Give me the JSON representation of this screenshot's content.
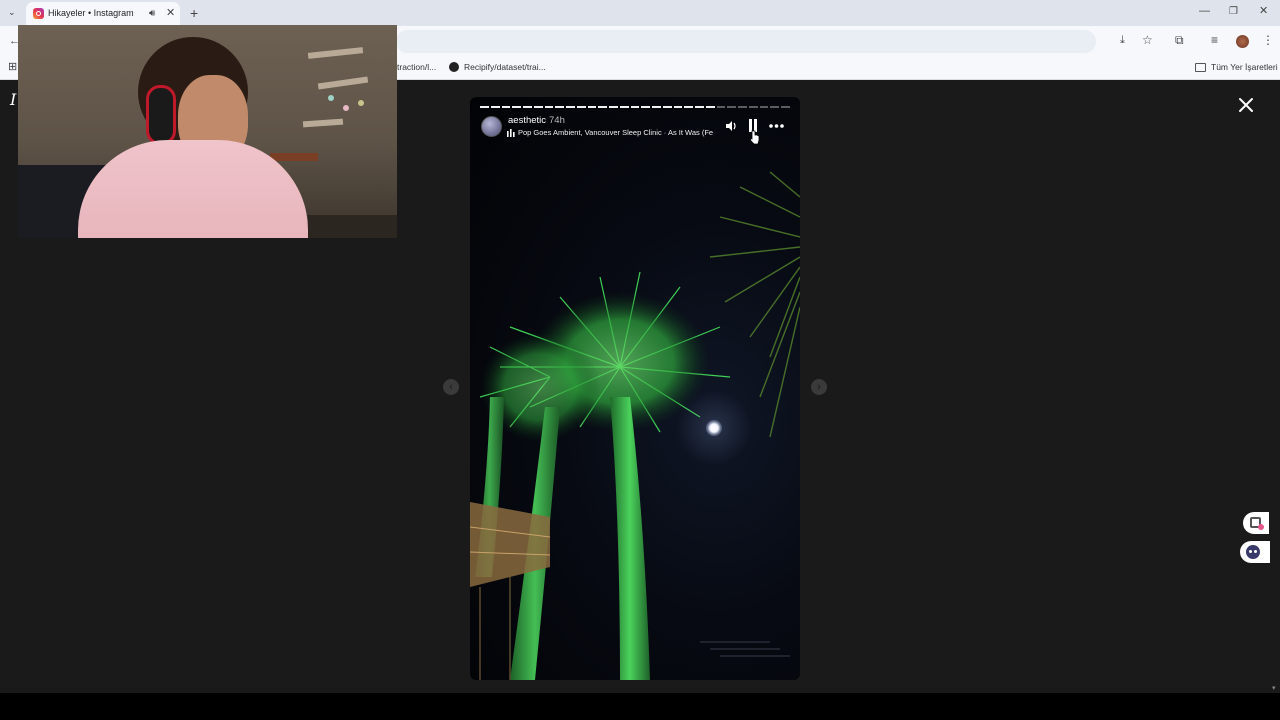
{
  "browser": {
    "tab_title": "Hikayeler • Instagram",
    "new_tab": "+",
    "bookmarks": [
      {
        "label": "traction/l..."
      },
      {
        "label": "Recipify/dataset/trai..."
      }
    ],
    "all_bookmarks": "Tüm Yer İşaretleri"
  },
  "story": {
    "username": "aesthetic",
    "time_ago": "74h",
    "music": "Pop Goes Ambient, Vancouver Sleep Clinic · As It Was (Fe",
    "progress_segments": 29,
    "progress_completed": 22
  },
  "colors": {
    "page_bg": "#1a1a1a",
    "story_bg": "#05070d",
    "palm_green": "#38c24a",
    "instagram_gradient": [
      "#f9a23a",
      "#e3334f",
      "#a83bc3"
    ]
  },
  "icons": {
    "close": "close-icon",
    "volume": "volume-icon",
    "pause": "pause-icon",
    "more": "more-icon",
    "prev": "chevron-left-icon",
    "next": "chevron-right-icon"
  }
}
